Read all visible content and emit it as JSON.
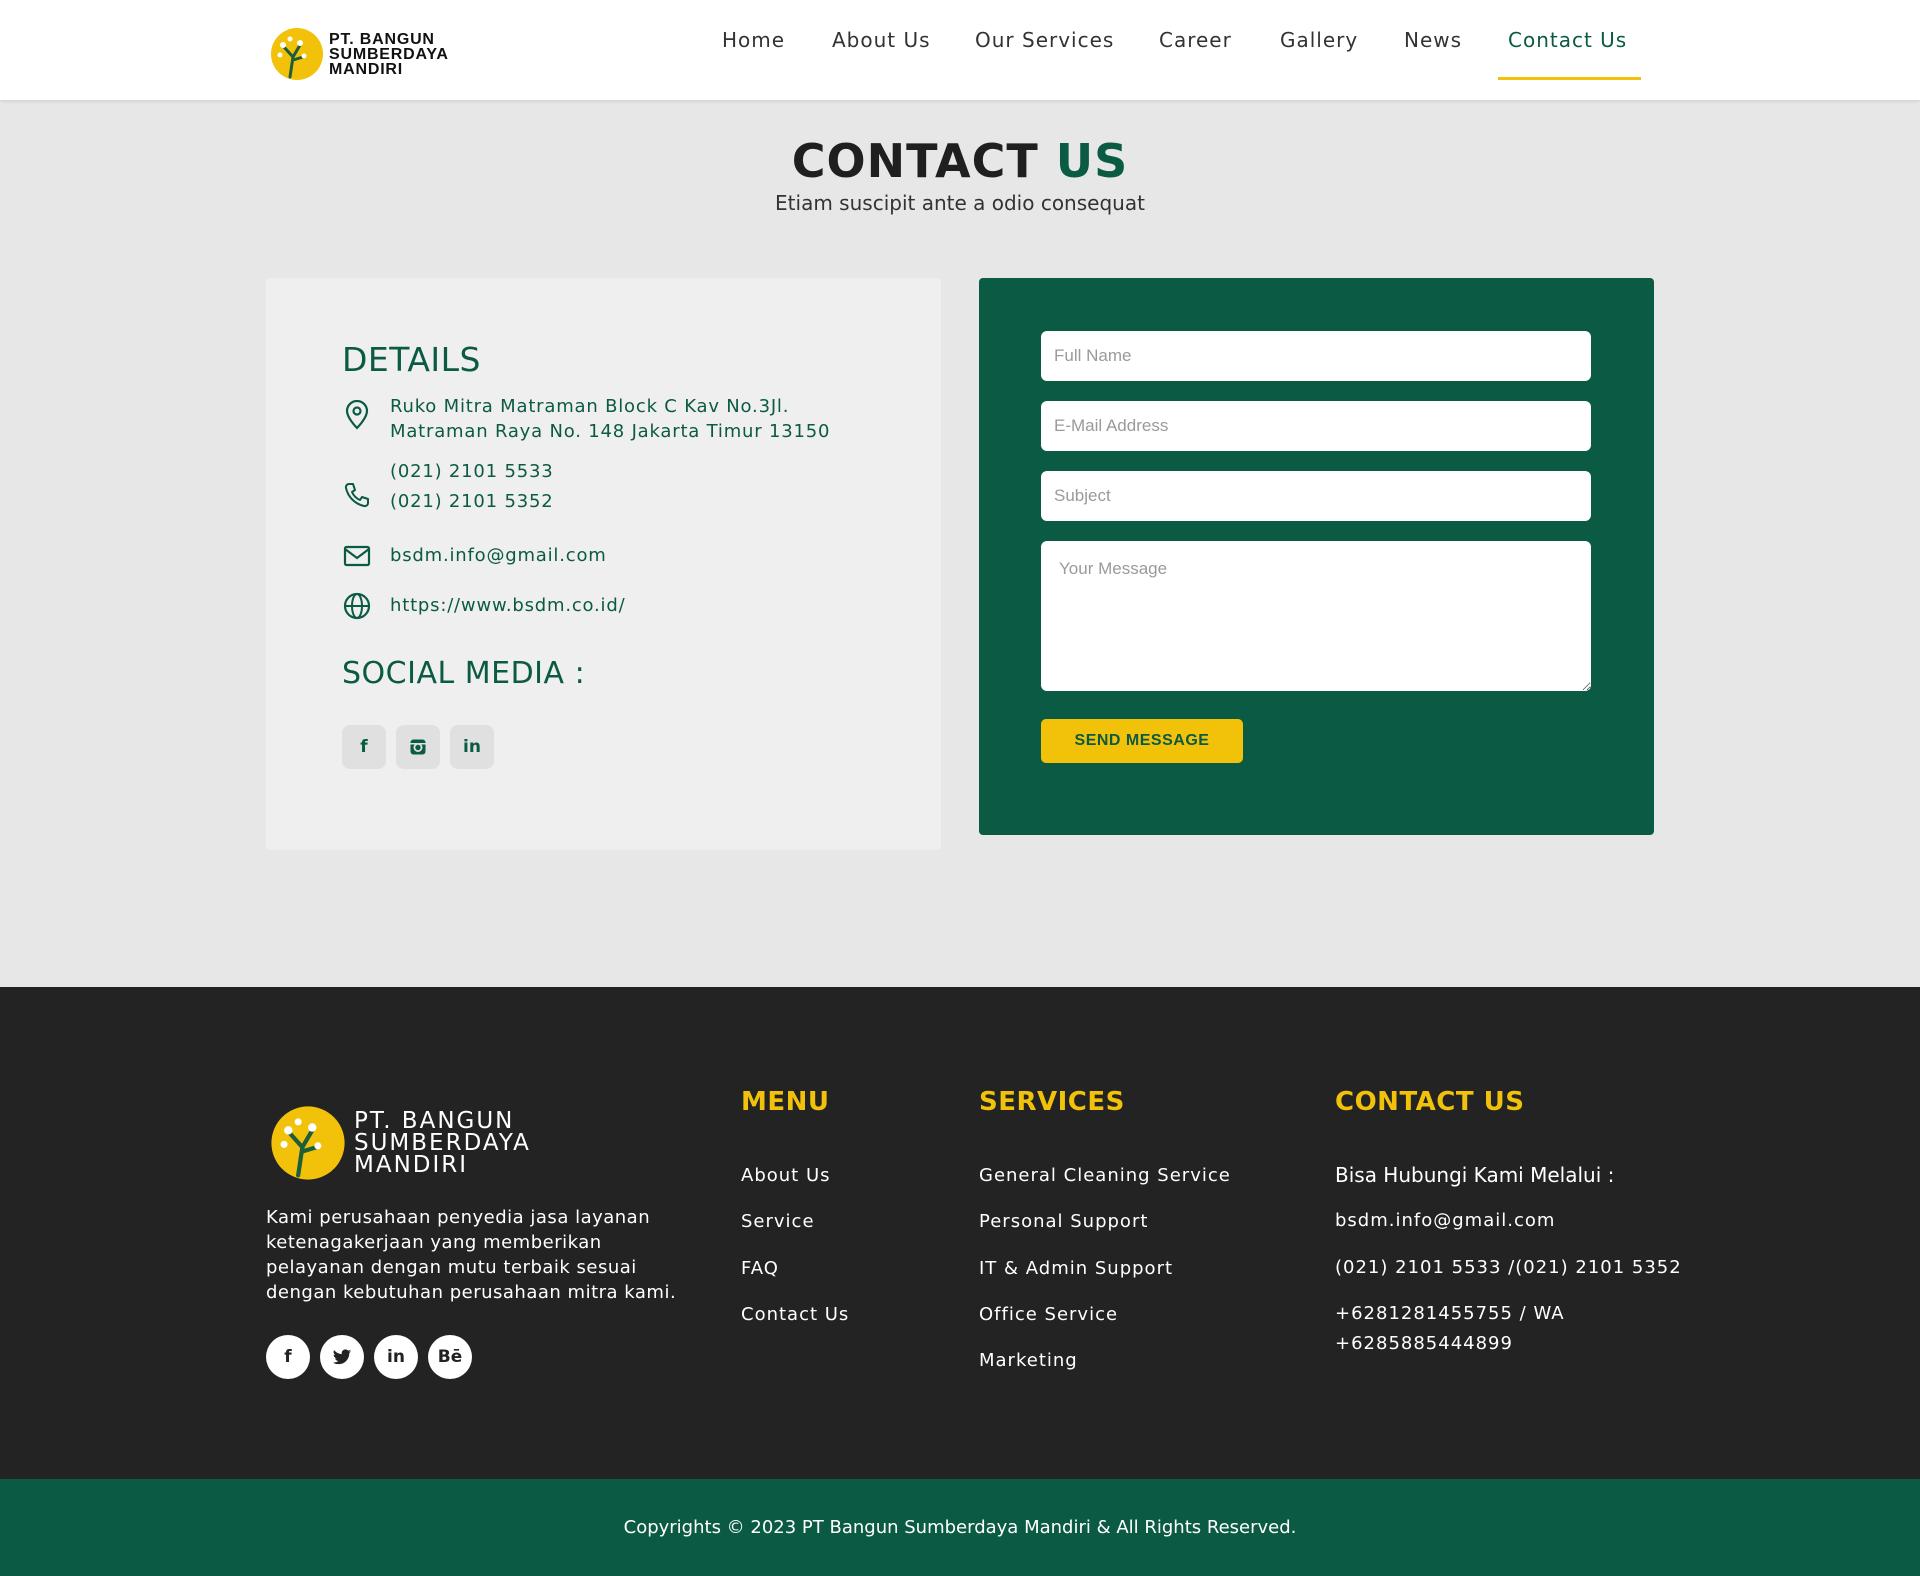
{
  "header": {
    "logo_lines": [
      "PT. BANGUN",
      "SUMBERDAYA",
      "MANDIRI"
    ],
    "nav": [
      "Home",
      "About Us",
      "Our Services",
      "Career",
      "Gallery",
      "News",
      "Contact Us"
    ],
    "active": "Contact Us"
  },
  "hero": {
    "title_main": "CONTACT",
    "title_accent": "US",
    "subtitle": "Etiam suscipit ante a odio consequat"
  },
  "details": {
    "heading": "DETAILS",
    "address": [
      "Ruko Mitra Matraman Block C Kav No.3Jl.",
      "Matraman Raya No. 148 Jakarta Timur 13150"
    ],
    "phones": [
      "(021) 2101 5533",
      "(021) 2101 5352"
    ],
    "email": "bsdm.info@gmail.com",
    "website": "https://www.bsdm.co.id/",
    "social_heading": "SOCIAL MEDIA :"
  },
  "form": {
    "name_placeholder": "Full Name",
    "email_placeholder": "E-Mail Address",
    "subject_placeholder": "Subject",
    "message_placeholder": "Your Message",
    "button": "SEND MESSAGE"
  },
  "footer": {
    "logo_lines": [
      "PT. BANGUN",
      "SUMBERDAYA",
      "MANDIRI"
    ],
    "description": [
      "Kami perusahaan penyedia jasa layanan",
      "ketenagakerjaan yang memberikan",
      "pelayanan dengan mutu terbaik sesuai",
      "dengan kebutuhan perusahaan mitra kami."
    ],
    "menu_heading": "MENU",
    "menu": [
      "About Us",
      "Service",
      "FAQ",
      "Contact Us"
    ],
    "services_heading": "SERVICES",
    "services": [
      "General Cleaning Service",
      "Personal Support",
      "IT & Admin Support",
      "Office Service",
      "Marketing"
    ],
    "contact_heading": "CONTACT US",
    "contact_intro": "Bisa Hubungi Kami Melalui :",
    "contact_email": "bsdm.info@gmail.com",
    "contact_phone": "(021) 2101 5533 /(021) 2101 5352",
    "contact_wa": [
      "+6281281455755 / WA",
      "+6285885444899"
    ],
    "social_glyphs": [
      "f",
      "t",
      "in",
      "Bē"
    ],
    "copyright": "Copyrights © 2023 PT Bangun Sumberdaya Mandiri & All Rights Reserved."
  },
  "colors": {
    "primary": "#0b5a44",
    "accent": "#f2c20a",
    "footer_bg": "#232323",
    "page_bg": "#e7e7e7"
  },
  "icons": [
    "map-pin-icon",
    "phone-icon",
    "mail-icon",
    "globe-icon",
    "facebook-icon",
    "instagram-icon",
    "linkedin-icon",
    "twitter-icon",
    "behance-icon"
  ]
}
